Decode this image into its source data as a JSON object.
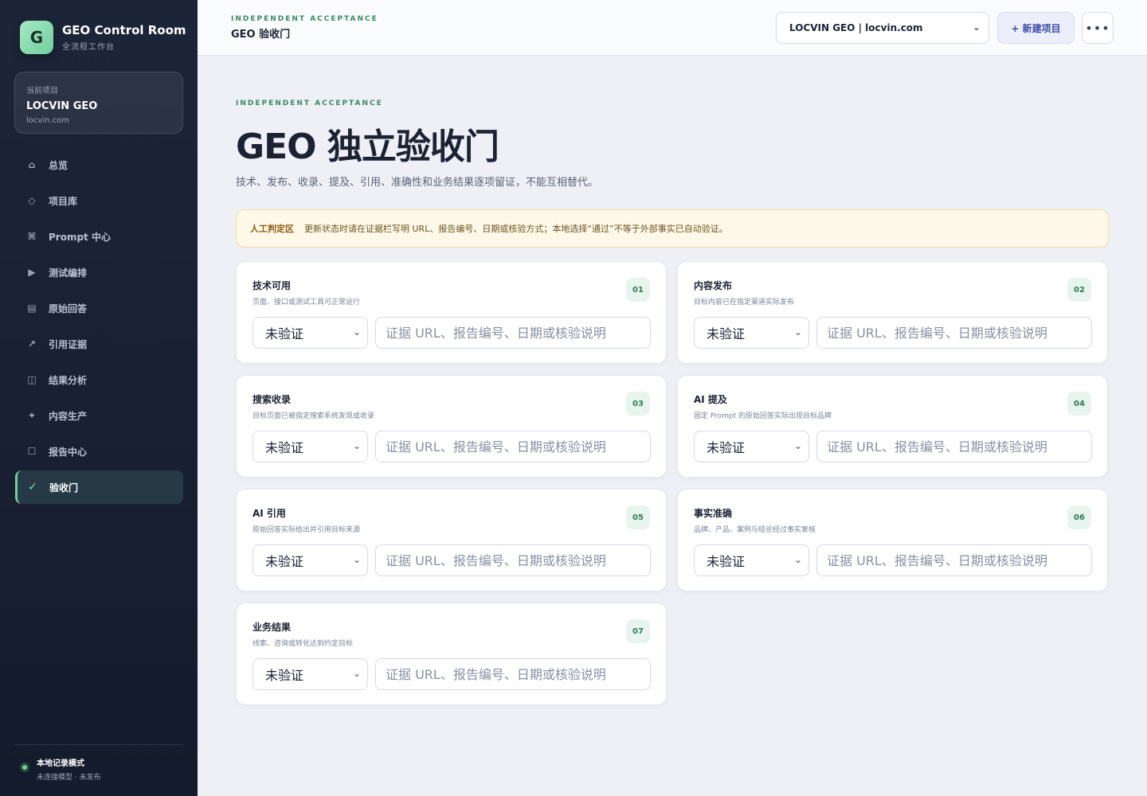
{
  "app": {
    "logo_letter": "G",
    "title": "GEO Control Room",
    "subtitle": "全流程工作台"
  },
  "current_project": {
    "label": "当前项目",
    "name": "LOCVIN GEO",
    "domain": "locvin.com"
  },
  "nav": [
    {
      "label": "总览",
      "icon": "home-icon",
      "glyph": "⌂"
    },
    {
      "label": "项目库",
      "icon": "diamond-icon",
      "glyph": "◇"
    },
    {
      "label": "Prompt 中心",
      "icon": "command-icon",
      "glyph": "⌘"
    },
    {
      "label": "测试编排",
      "icon": "play-icon",
      "glyph": "▶"
    },
    {
      "label": "原始回答",
      "icon": "document-icon",
      "glyph": "▤"
    },
    {
      "label": "引用证据",
      "icon": "arrow-up-right-icon",
      "glyph": "↗"
    },
    {
      "label": "结果分析",
      "icon": "columns-icon",
      "glyph": "◫"
    },
    {
      "label": "内容生产",
      "icon": "sparkle-icon",
      "glyph": "✦"
    },
    {
      "label": "报告中心",
      "icon": "square-icon",
      "glyph": "☐"
    },
    {
      "label": "验收门",
      "icon": "check-icon",
      "glyph": "✓",
      "active": true
    }
  ],
  "mode": {
    "title": "本地记录模式",
    "subtitle": "未连接模型 · 未发布"
  },
  "topbar": {
    "eyebrow": "INDEPENDENT ACCEPTANCE",
    "title": "GEO 验收门",
    "project_select": "LOCVIN GEO | locvin.com",
    "new_project": "+ 新建项目",
    "more": "•••"
  },
  "page": {
    "eyebrow": "INDEPENDENT ACCEPTANCE",
    "title": "GEO 独立验收门",
    "description": "技术、发布、收录、提及、引用、准确性和业务结果逐项留证，不能互相替代。"
  },
  "notice": {
    "label": "人工判定区",
    "text": "更新状态时请在证据栏写明 URL、报告编号、日期或核验方式；本地选择“通过”不等于外部事实已自动验证。"
  },
  "cards": [
    {
      "title": "技术可用",
      "subtitle": "页面、接口或测试工具可正常运行",
      "number": "01",
      "status": "未验证",
      "placeholder": "证据 URL、报告编号、日期或核验说明"
    },
    {
      "title": "内容发布",
      "subtitle": "目标内容已在指定渠道实际发布",
      "number": "02",
      "status": "未验证",
      "placeholder": "证据 URL、报告编号、日期或核验说明"
    },
    {
      "title": "搜索收录",
      "subtitle": "目标页面已被指定搜索系统发现或收录",
      "number": "03",
      "status": "未验证",
      "placeholder": "证据 URL、报告编号、日期或核验说明"
    },
    {
      "title": "AI 提及",
      "subtitle": "固定 Prompt 的原始回答实际出现目标品牌",
      "number": "04",
      "status": "未验证",
      "placeholder": "证据 URL、报告编号、日期或核验说明"
    },
    {
      "title": "AI 引用",
      "subtitle": "原始回答实际给出并引用目标来源",
      "number": "05",
      "status": "未验证",
      "placeholder": "证据 URL、报告编号、日期或核验说明"
    },
    {
      "title": "事实准确",
      "subtitle": "品牌、产品、案例与结论经过事实复核",
      "number": "06",
      "status": "未验证",
      "placeholder": "证据 URL、报告编号、日期或核验说明"
    },
    {
      "title": "业务结果",
      "subtitle": "线索、咨询或转化达到约定目标",
      "number": "07",
      "status": "未验证",
      "placeholder": "证据 URL、报告编号、日期或核验说明"
    }
  ],
  "colors": {
    "accent_green": "#3b8a63",
    "sidebar_bg": "#1c2538",
    "notice_bg": "#fdf8e7",
    "primary_blue": "#3d4ea8"
  }
}
